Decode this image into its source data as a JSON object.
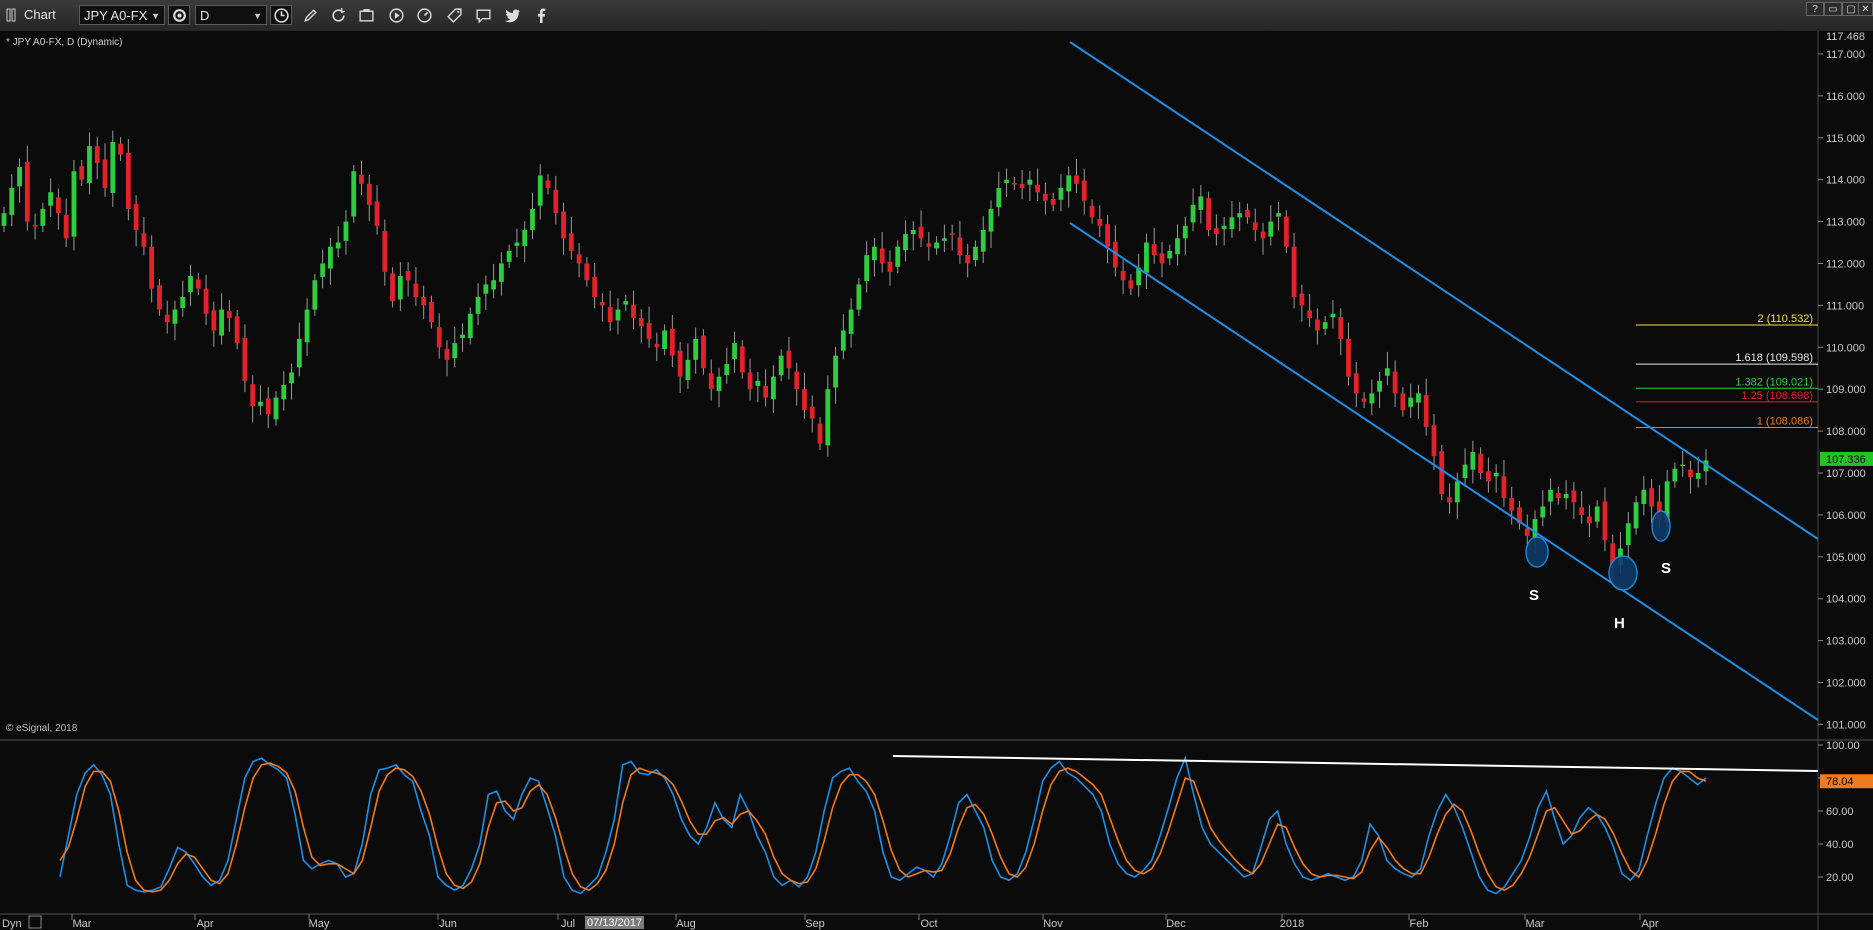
{
  "toolbar": {
    "title": "Chart",
    "symbol": "JPY A0-FX",
    "interval": "D",
    "icons": [
      "chart-window-icon",
      "settings-icon",
      "clock-icon",
      "pencil-icon",
      "refresh-icon",
      "screenshot-icon",
      "play-icon",
      "speed-icon",
      "tag-icon",
      "comment-icon",
      "twitter-icon",
      "facebook-icon"
    ]
  },
  "window_buttons": [
    "?",
    "▭",
    "▢",
    "✕"
  ],
  "symbol_label": "* JPY A0-FX, D (Dynamic)",
  "copyright": "© eSignal, 2018",
  "bottom_left": "Dyn",
  "date_highlight": "07/13/2017",
  "colors": {
    "up": "#2ecc40",
    "down": "#e0222a",
    "channel": "#1e8fe6",
    "stoch_k": "#1e8fe6",
    "stoch_d": "#f07a1e",
    "fib_2": "#f0e040",
    "fib_1618": "#e8e8e8",
    "fib_1382": "#2ecc40",
    "fib_125": "#e0222a",
    "fib_1": "#f07a1e",
    "price_tag": "#22c422",
    "stoch_tag": "#f07a1e"
  },
  "head_shoulders": {
    "left": "S",
    "head": "H",
    "right": "S"
  },
  "chart_data": [
    {
      "type": "candlestick",
      "title": "JPY A0-FX, D (Dynamic)",
      "x_months": [
        "Mar",
        "Apr",
        "May",
        "Jun",
        "Jul",
        "Aug",
        "Sep",
        "Oct",
        "Nov",
        "Dec",
        "2018",
        "Feb",
        "Mar",
        "Apr"
      ],
      "ylim": [
        100.7,
        117.5
      ],
      "y_ticks": [
        "101.000",
        "102.000",
        "103.000",
        "104.000",
        "105.000",
        "106.000",
        "107.000",
        "108.000",
        "109.000",
        "110.000",
        "111.000",
        "112.000",
        "113.000",
        "114.000",
        "115.000",
        "116.000",
        "117.000"
      ],
      "y_top_label": "117.468",
      "last_price": "107.336",
      "closes": [
        113.2,
        113.8,
        114.3,
        113.0,
        112.9,
        113.3,
        113.7,
        113.2,
        112.6,
        114.2,
        114.0,
        114.8,
        114.4,
        113.8,
        114.9,
        114.6,
        113.3,
        112.8,
        112.4,
        111.4,
        110.9,
        110.6,
        110.9,
        111.2,
        111.7,
        111.4,
        110.8,
        110.4,
        110.9,
        110.7,
        110.1,
        109.2,
        108.6,
        108.7,
        108.4,
        108.8,
        109.1,
        109.4,
        110.2,
        110.9,
        111.6,
        112.0,
        112.4,
        112.5,
        113.0,
        114.2,
        113.9,
        113.4,
        112.9,
        111.8,
        111.1,
        111.7,
        111.6,
        111.2,
        111.0,
        110.6,
        110.0,
        109.7,
        110.1,
        110.3,
        110.8,
        111.2,
        111.5,
        111.6,
        112.0,
        112.3,
        112.5,
        112.8,
        113.3,
        114.1,
        113.8,
        113.2,
        112.6,
        112.3,
        112.0,
        111.6,
        111.2,
        111.0,
        110.6,
        110.9,
        111.1,
        110.7,
        110.5,
        110.2,
        110.0,
        110.4,
        109.8,
        109.3,
        109.7,
        110.2,
        109.5,
        109.0,
        109.3,
        109.6,
        110.1,
        109.4,
        109.0,
        109.2,
        108.8,
        109.3,
        109.8,
        109.5,
        109.0,
        108.5,
        108.3,
        107.7,
        109.0,
        109.8,
        110.4,
        110.9,
        111.5,
        112.2,
        112.4,
        112.0,
        111.8,
        112.4,
        112.7,
        112.8,
        112.6,
        112.4,
        112.5,
        112.6,
        112.7,
        112.2,
        112.0,
        112.4,
        112.8,
        113.3,
        113.8,
        114.0,
        113.9,
        113.8,
        114.0,
        113.7,
        113.5,
        113.4,
        113.8,
        114.1,
        113.9,
        113.5,
        113.1,
        112.9,
        112.4,
        111.9,
        111.6,
        111.4,
        111.9,
        112.5,
        112.2,
        112.0,
        112.3,
        112.6,
        112.9,
        113.4,
        113.6,
        112.8,
        112.7,
        112.9,
        113.1,
        113.2,
        113.1,
        112.8,
        112.6,
        113.0,
        113.2,
        112.4,
        111.2,
        111.0,
        110.7,
        110.4,
        110.6,
        110.8,
        110.2,
        109.3,
        108.9,
        108.7,
        108.9,
        109.2,
        109.5,
        108.9,
        108.5,
        108.8,
        108.9,
        108.1,
        107.4,
        106.5,
        106.3,
        106.8,
        107.2,
        107.5,
        107.0,
        106.8,
        107.0,
        106.4,
        106.1,
        105.8,
        105.5,
        105.9,
        106.2,
        106.6,
        106.4,
        106.5,
        106.3,
        106.0,
        105.8,
        106.2,
        105.4,
        104.8,
        105.2,
        105.8,
        106.3,
        106.6,
        106.2,
        105.9,
        106.8,
        107.1,
        107.2,
        106.9,
        107.0,
        107.3
      ]
    },
    {
      "type": "line",
      "title": "Stochastic",
      "ylim": [
        0,
        100
      ],
      "y_ticks": [
        "20.00",
        "40.00",
        "60.00",
        "80.00",
        "100.00"
      ],
      "last_value": "78.04",
      "series": [
        {
          "name": "%K",
          "values": [
            20,
            45,
            70,
            83,
            88,
            82,
            70,
            40,
            15,
            12,
            11,
            12,
            14,
            25,
            38,
            35,
            28,
            20,
            15,
            18,
            30,
            55,
            80,
            90,
            92,
            88,
            85,
            80,
            58,
            30,
            25,
            28,
            30,
            28,
            20,
            22,
            40,
            70,
            85,
            86,
            88,
            82,
            78,
            60,
            45,
            20,
            15,
            12,
            15,
            25,
            40,
            70,
            72,
            60,
            55,
            70,
            80,
            78,
            62,
            45,
            20,
            12,
            10,
            15,
            20,
            35,
            55,
            88,
            90,
            83,
            82,
            85,
            80,
            70,
            55,
            45,
            40,
            50,
            65,
            55,
            50,
            70,
            60,
            45,
            35,
            20,
            15,
            18,
            14,
            20,
            35,
            60,
            80,
            84,
            86,
            78,
            72,
            60,
            35,
            20,
            18,
            22,
            26,
            24,
            20,
            28,
            45,
            65,
            70,
            60,
            50,
            30,
            20,
            18,
            22,
            35,
            55,
            78,
            86,
            90,
            83,
            80,
            75,
            70,
            60,
            40,
            28,
            22,
            20,
            24,
            30,
            45,
            62,
            80,
            92,
            70,
            50,
            40,
            35,
            30,
            25,
            20,
            22,
            38,
            55,
            60,
            40,
            28,
            20,
            18,
            20,
            22,
            20,
            18,
            20,
            30,
            52,
            45,
            30,
            25,
            22,
            20,
            25,
            45,
            60,
            70,
            62,
            50,
            35,
            20,
            12,
            10,
            14,
            22,
            30,
            44,
            62,
            72,
            55,
            40,
            45,
            56,
            62,
            58,
            50,
            38,
            22,
            18,
            24,
            45,
            64,
            80,
            86,
            84,
            80,
            76,
            80
          ]
        },
        {
          "name": "%D",
          "values": [
            30,
            38,
            55,
            75,
            84,
            84,
            78,
            60,
            35,
            18,
            12,
            11,
            12,
            18,
            28,
            34,
            32,
            25,
            18,
            16,
            22,
            40,
            62,
            80,
            88,
            89,
            87,
            83,
            72,
            50,
            32,
            27,
            28,
            28,
            25,
            22,
            30,
            50,
            72,
            82,
            86,
            85,
            81,
            72,
            58,
            38,
            22,
            15,
            13,
            17,
            28,
            50,
            65,
            66,
            60,
            62,
            72,
            76,
            70,
            56,
            38,
            22,
            14,
            12,
            16,
            24,
            40,
            65,
            82,
            86,
            84,
            83,
            81,
            76,
            66,
            54,
            46,
            46,
            54,
            56,
            52,
            58,
            60,
            54,
            46,
            32,
            22,
            18,
            16,
            17,
            25,
            42,
            62,
            76,
            82,
            82,
            78,
            70,
            54,
            36,
            24,
            20,
            22,
            24,
            23,
            24,
            34,
            50,
            62,
            64,
            58,
            46,
            32,
            22,
            20,
            26,
            40,
            60,
            76,
            84,
            86,
            84,
            80,
            76,
            70,
            56,
            42,
            30,
            24,
            22,
            25,
            34,
            48,
            64,
            80,
            78,
            64,
            50,
            42,
            36,
            30,
            25,
            22,
            28,
            40,
            52,
            50,
            38,
            28,
            22,
            20,
            21,
            21,
            20,
            19,
            23,
            36,
            44,
            38,
            30,
            25,
            22,
            22,
            32,
            46,
            58,
            64,
            60,
            48,
            34,
            22,
            14,
            12,
            15,
            22,
            32,
            46,
            60,
            62,
            54,
            46,
            48,
            54,
            58,
            55,
            46,
            34,
            24,
            20,
            30,
            46,
            64,
            78,
            84,
            84,
            80,
            78
          ]
        }
      ]
    }
  ],
  "fib_levels": [
    {
      "label": "2 (110.532)",
      "value": 110.532,
      "color_key": "fib_2"
    },
    {
      "label": "1.618 (109.598)",
      "value": 109.598,
      "color_key": "fib_1618"
    },
    {
      "label": "1.382 (109.021)",
      "value": 109.021,
      "color_key": "fib_1382"
    },
    {
      "label": "1.25 (108.698)",
      "value": 108.698,
      "color_key": "fib_125"
    },
    {
      "label": "1 (108.086)",
      "value": 108.086,
      "color_key": "fib_1"
    }
  ]
}
